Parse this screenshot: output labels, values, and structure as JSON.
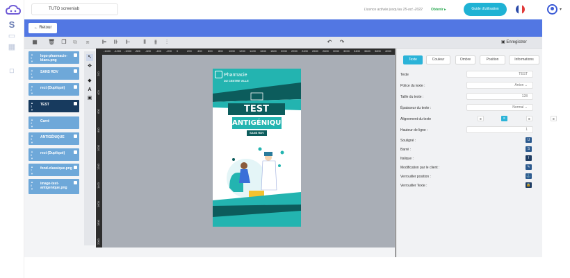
{
  "topbar": {
    "doc_title": "TUTO screenlab",
    "licence": "Licence activée jusqu'au 25-oct.-2022",
    "obtenir": "Obtenir ▸",
    "guide": "Guide d'utilisation",
    "caret": "▾"
  },
  "nav": {
    "back": "← Retour"
  },
  "toolbar": {
    "save": "Enregistrer"
  },
  "layers": [
    {
      "name": "logo-pharmacie-blanc.png",
      "locked": true,
      "selected": false
    },
    {
      "name": "SANS RDV",
      "locked": true,
      "selected": false
    },
    {
      "name": "rect (Dupliqué)",
      "locked": true,
      "selected": false
    },
    {
      "name": "TEST",
      "locked": true,
      "selected": true
    },
    {
      "name": "Carré",
      "locked": false,
      "selected": false
    },
    {
      "name": "ANTIGÉNIQUE",
      "locked": true,
      "selected": false
    },
    {
      "name": "rect (Dupliqué)",
      "locked": true,
      "selected": false
    },
    {
      "name": "fond-classique.png",
      "locked": true,
      "selected": false
    },
    {
      "name": "image-test-antigenique.png",
      "locked": true,
      "selected": false
    }
  ],
  "ruler": {
    "h": [
      "-1400",
      "-1200",
      "-1000",
      "-800",
      "-600",
      "-400",
      "-200",
      "0",
      "200",
      "400",
      "600",
      "800",
      "1000",
      "1200",
      "1400",
      "1600",
      "1800",
      "2000",
      "2200",
      "2400",
      "2600",
      "2800",
      "3000",
      "3200",
      "3400",
      "3600",
      "3800",
      "4000"
    ],
    "v": [
      "200",
      "400",
      "600",
      "800",
      "1000",
      "1200",
      "1400",
      "1600",
      "1800",
      "2000"
    ]
  },
  "poster": {
    "brand_line1": "Pharmacie",
    "brand_line2": "DU CENTRE VILLE",
    "title1": "TEST",
    "title2": "ANTIGÉNIQUE",
    "tag": "SANS RDV"
  },
  "props": {
    "tabs": [
      "Texte",
      "Couleur",
      "Ombre",
      "Position",
      "Informations"
    ],
    "active_tab": "Texte",
    "rows": [
      {
        "label": "Texte",
        "value": "TEST"
      },
      {
        "label": "Police du texte :",
        "value": "Anton"
      },
      {
        "label": "Taille du texte :",
        "value": "128"
      },
      {
        "label": "Épaisseur du texte :",
        "value": "Normal"
      },
      {
        "label": "Alignement du texte",
        "value": ""
      },
      {
        "label": "Hauteur de ligne :",
        "value": "1"
      },
      {
        "label": "Souligné :",
        "value": "U"
      },
      {
        "label": "Barré :",
        "value": "S"
      },
      {
        "label": "Italique :",
        "value": "I"
      },
      {
        "label": "Modification par le client :",
        "value": "✎"
      },
      {
        "label": "Verrouiller position :",
        "value": "⚓"
      },
      {
        "label": "Verrouiller Texte :",
        "value": "🔒"
      }
    ]
  },
  "colors": {
    "accent": "#5277e3",
    "teal": "#2bb3d8",
    "poster_teal": "#23b4b0",
    "poster_dark": "#0c5c5c",
    "selected_layer": "#173a5e",
    "layer": "#6ea8d9"
  }
}
